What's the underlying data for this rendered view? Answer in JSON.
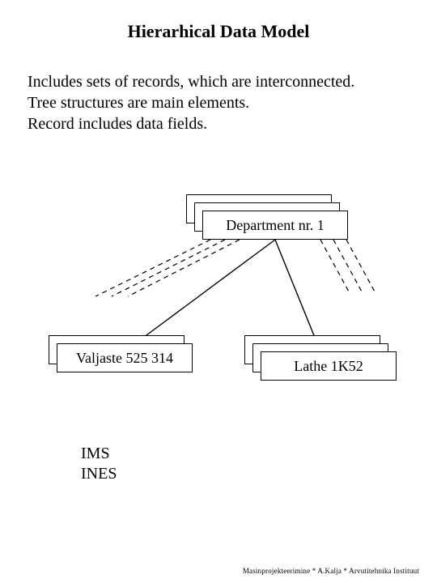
{
  "title": "Hierarhical Data Model",
  "paragraph": {
    "line1": "Includes sets of records, which are interconnected.",
    "line2": "Tree structures are main elements.",
    "line3": "Record includes data fields."
  },
  "nodes": {
    "root": "Department nr. 1",
    "left": "Valjaste 525 314",
    "right": "Lathe 1K52"
  },
  "notes": {
    "line1": "IMS",
    "line2": "INES"
  },
  "footer": "Masinprojekteerimine * A.Kalja * Arvutitehnika Instituut"
}
